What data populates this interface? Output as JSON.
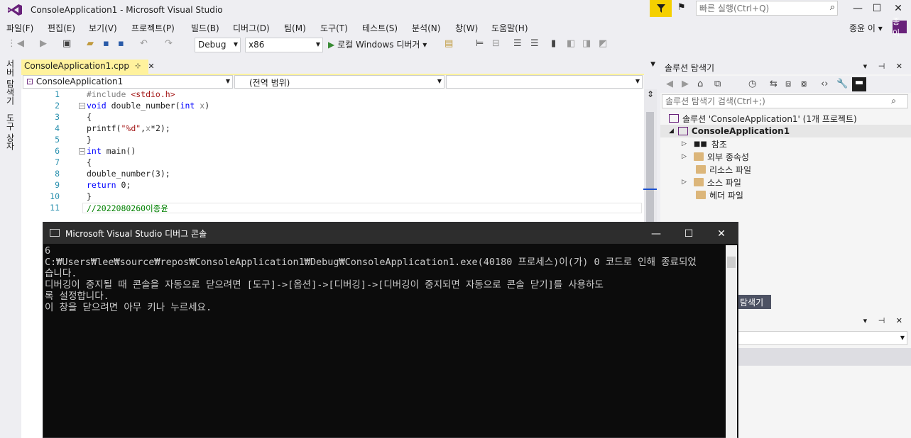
{
  "window": {
    "title": "ConsoleApplication1 - Microsoft Visual Studio",
    "quick_launch_placeholder": "빠른 실행(Ctrl+Q)",
    "minimize": "—",
    "maximize": "☐",
    "close": "✕"
  },
  "menu": [
    "파일(F)",
    "편집(E)",
    "보기(V)",
    "프로젝트(P)",
    "빌드(B)",
    "디버그(D)",
    "팀(M)",
    "도구(T)",
    "테스트(S)",
    "분석(N)",
    "창(W)",
    "도움말(H)"
  ],
  "account": {
    "name": "종윤 이 ▾",
    "avatar": "종이"
  },
  "toolbar": {
    "config": "Debug",
    "platform": "x86",
    "run_label": "로컬 Windows 디버거 ▾"
  },
  "left_strip": {
    "server_explorer": "서버 탐색기",
    "toolbox": "도구 상자"
  },
  "editor": {
    "tab_label": "ConsoleApplication1.cpp",
    "tab_pin": "⊹",
    "tab_close": "✕",
    "nav_project": "ConsoleApplication1",
    "nav_scope": "(전역 범위)",
    "nav_member": "",
    "line_numbers": [
      "1",
      "2",
      "3",
      "4",
      "5",
      "6",
      "7",
      "8",
      "9",
      "10",
      "11"
    ],
    "lines": {
      "l1_directive": "#include ",
      "l1_header": "<stdio.h>",
      "l2_kw": "void",
      "l2_name": " double_number(",
      "l2_kw2": "int",
      "l2_param": " x",
      "l2_end": ")",
      "l3": "{",
      "l4_a": "printf(",
      "l4_str": "\"%d\"",
      "l4_b": ",",
      "l4_param": "x",
      "l4_c": "*2);",
      "l5": "}",
      "l6_kw": "int",
      "l6_rest": " main()",
      "l7": "{",
      "l8": "double_number(3);",
      "l9_kw": "return",
      "l9_rest": " 0;",
      "l10": "}",
      "l11_comment": "//2022080260이종윤"
    }
  },
  "solution_explorer": {
    "title": "솔루션 탐색기",
    "head_buttons": "▾ ⊣ ✕",
    "search_placeholder": "솔루션 탐색기 검색(Ctrl+;)",
    "tree": [
      {
        "label": "솔루션 'ConsoleApplication1' (1개 프로젝트)"
      },
      {
        "label": "ConsoleApplication1"
      },
      {
        "label": "참조"
      },
      {
        "label": "외부 종속성"
      },
      {
        "label": "리소스 파일"
      },
      {
        "label": "소스 파일"
      },
      {
        "label": "헤더 파일"
      }
    ],
    "bottom_tab": "탐색기"
  },
  "console": {
    "title": "Microsoft Visual Studio 디버그 콘솔",
    "output": "6\nC:₩Users₩lee₩source₩repos₩ConsoleApplication1₩Debug₩ConsoleApplication1.exe(40180 프로세스)이(가) 0 코드로 인해 종료되었\n습니다.\n디버깅이 중지될 때 콘솔을 자동으로 닫으려면 [도구]->[옵션]->[디버깅]->[디버깅이 중지되면 자동으로 콘솔 닫기]를 사용하도\n록 설정합니다.\n이 창을 닫으려면 아무 키나 누르세요."
  },
  "colors": {
    "accent_yellow": "#fff29d",
    "filter_yellow": "#f5d000",
    "vs_purple": "#68217a",
    "console_bg": "#0c0c0c"
  }
}
